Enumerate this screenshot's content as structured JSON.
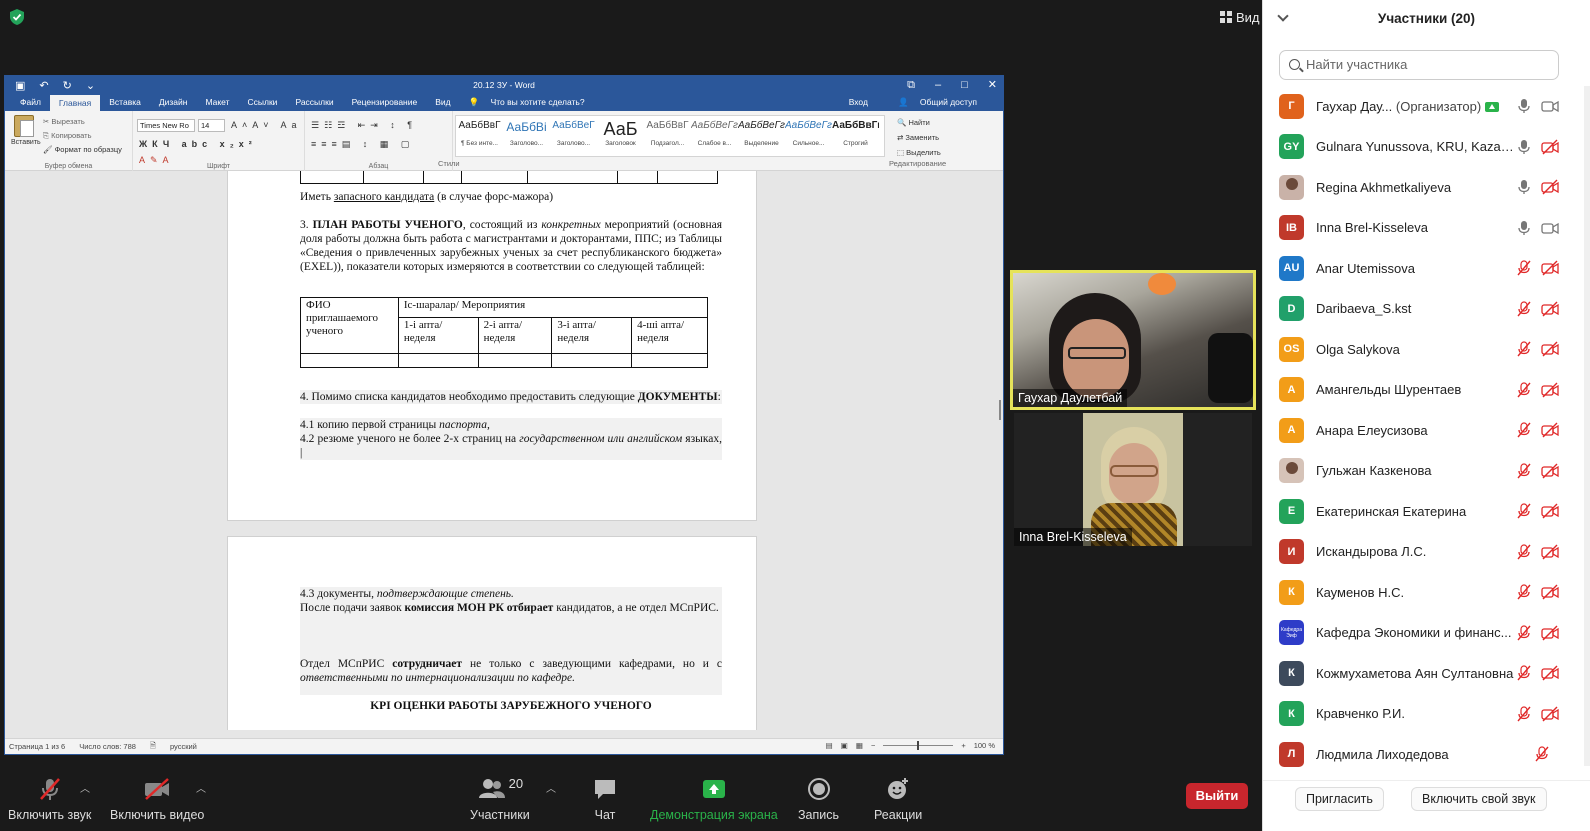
{
  "zoom_top": {
    "view_label": "Вид"
  },
  "word": {
    "doc_title": "20.12 ЗУ - Word",
    "tabs": [
      "Файл",
      "Главная",
      "Вставка",
      "Дизайн",
      "Макет",
      "Ссылки",
      "Рассылки",
      "Рецензирование",
      "Вид"
    ],
    "active_tab": "Главная",
    "tell_me": "Что вы хотите сделать?",
    "signin": "Вход",
    "share": "Общий доступ",
    "clipboard": {
      "paste": "Вставить",
      "cut": "Вырезать",
      "copy": "Копировать",
      "format": "Формат по образцу",
      "group": "Буфер обмена"
    },
    "font": {
      "name": "Times New Ro",
      "size": "14",
      "group": "Шрифт"
    },
    "paragraph_group": "Абзац",
    "styles_group": "Стили",
    "styles": [
      {
        "preview": "АаБбВвГ",
        "name": "¶ Без инте..."
      },
      {
        "preview": "АаБбВі",
        "name": "Заголово..."
      },
      {
        "preview": "АаБбВеГ",
        "name": "Заголово..."
      },
      {
        "preview": "АаБ",
        "name": "Заголовок"
      },
      {
        "preview": "АаБбВвГ",
        "name": "Подзагол..."
      },
      {
        "preview": "АаБбВеГг",
        "name": "Слабое в..."
      },
      {
        "preview": "АаБбВеГг",
        "name": "Выделение"
      },
      {
        "preview": "АаБбВеГг",
        "name": "Сильное..."
      },
      {
        "preview": "АаБбВвГг,",
        "name": "Строгий"
      }
    ],
    "editing": {
      "find": "Найти",
      "replace": "Заменить",
      "select": "Выделить",
      "group": "Редактирование"
    },
    "doc": {
      "p_reserve_a": "Иметь ",
      "p_reserve_u": "запасного кандидата",
      "p_reserve_b": " (в случае форс-мажора)",
      "p3_num": "3. ",
      "p3_bold": "ПЛАН РАБОТЫ УЧЕНОГО",
      "p3_a": ", состоящий из ",
      "p3_i": "конкретных",
      "p3_b": " мероприятий (основная доля работы должна быть работа с магистрантами и докторантами, ППС; из Таблицы «Сведения о привлеченных зарубежных ученых за счет республиканского бюджета» (EXEL)), показатели которых измеряются в соответствии со следующей таблицей:",
      "table": {
        "col1": "ФИО приглашаемого ученого",
        "events": "Іс-шаралар/ Мероприятия",
        "weeks": [
          "1-і апта/неделя",
          "2-і апта/неделя",
          "3-і апта/неделя",
          "4-ші апта/неделя"
        ]
      },
      "p4_a": "4. Помимо списка кандидатов необходимо предоставить следующие ",
      "p4_bold": "ДОКУМЕНТЫ",
      "p4_b": ":",
      "p41_a": "4.1 копию первой страницы ",
      "p41_i": "паспорта,",
      "p42_a": "4.2 резюме ученого не более 2-х страниц на ",
      "p42_i": "государственном или английском",
      "p42_b": " языках,",
      "p43_a": "4.3 документы, ",
      "p43_i": "подтверждающие степень.",
      "p_after_a": "После подачи заявок ",
      "p_after_bold": "комиссия МОН РК отбирает",
      "p_after_b": " кандидатов, а не отдел МСпРИС.",
      "p_dept_a": "Отдел МСпРИС ",
      "p_dept_bold": "сотрудничает",
      "p_dept_b": " не только с заведующими кафедрами, но и с ",
      "p_dept_i": "ответственными по интернационализации по кафедре.",
      "kpi": "KPI ОЦЕНКИ РАБОТЫ ЗАРУБЕЖНОГО УЧЕНОГО"
    },
    "status": {
      "page": "Страница 1 из 6",
      "words": "Число слов: 788",
      "lang": "русский",
      "zoom": "100 %"
    }
  },
  "videos": [
    {
      "name": "Гаухар Даулетбай"
    },
    {
      "name": "Inna Brel-Kisseleva"
    }
  ],
  "toolbar": {
    "mute": "Включить звук",
    "video": "Включить видео",
    "participants": "Участники",
    "participants_count": "20",
    "chat": "Чат",
    "share": "Демонстрация экрана",
    "record": "Запись",
    "reactions": "Реакции",
    "leave": "Выйти"
  },
  "panel": {
    "title": "Участники (20)",
    "search_placeholder": "Найти участника",
    "participants": [
      {
        "initials": "Г",
        "color": "#e0621c",
        "name": "Гаухар Дау...",
        "role": "(Организатор)",
        "mic": "on",
        "cam": "on"
      },
      {
        "initials": "GY",
        "color": "#23a35a",
        "name": "Gulnara Yunussova, KRU, Kazak...",
        "mic": "on",
        "cam": "off"
      },
      {
        "initials": "",
        "color": "#c9b2a8",
        "name": "Regina Akhmetkaliyeva",
        "mic": "on",
        "cam": "off"
      },
      {
        "initials": "IB",
        "color": "#c0392b",
        "name": "Inna Brel-Kisseleva",
        "mic": "on",
        "cam": "on"
      },
      {
        "initials": "AU",
        "color": "#1f78c8",
        "name": "Anar Utemissova",
        "mic": "off",
        "cam": "off"
      },
      {
        "initials": "D",
        "color": "#21a06a",
        "name": "Daribaeva_S.kst",
        "mic": "off",
        "cam": "off"
      },
      {
        "initials": "OS",
        "color": "#f29d18",
        "name": "Olga Salykova",
        "mic": "off",
        "cam": "off"
      },
      {
        "initials": "А",
        "color": "#f29d18",
        "name": "Амангельды Шурентаев",
        "mic": "off",
        "cam": "off"
      },
      {
        "initials": "А",
        "color": "#f29d18",
        "name": "Анара Елеусизова",
        "mic": "off",
        "cam": "off"
      },
      {
        "initials": "",
        "color": "#d6c3b8",
        "name": "Гульжан Казкенова",
        "mic": "off",
        "cam": "off"
      },
      {
        "initials": "Е",
        "color": "#23a35a",
        "name": "Екатеринская Екатерина",
        "mic": "off",
        "cam": "off"
      },
      {
        "initials": "И",
        "color": "#c0392b",
        "name": "Искандырова Л.С.",
        "mic": "off",
        "cam": "off"
      },
      {
        "initials": "К",
        "color": "#f29d18",
        "name": "Кауменов Н.С.",
        "mic": "off",
        "cam": "off"
      },
      {
        "initials": "Кафедра Эиф",
        "color": "#2e3cc8",
        "name": "Кафедра Экономики и финанс...",
        "mic": "off",
        "cam": "off"
      },
      {
        "initials": "К",
        "color": "#3d4a5c",
        "name": "Кожмухаметова Аян Султановна",
        "mic": "off",
        "cam": "off"
      },
      {
        "initials": "К",
        "color": "#23a35a",
        "name": "Кравченко Р.И.",
        "mic": "off",
        "cam": "off"
      },
      {
        "initials": "Л",
        "color": "#c0392b",
        "name": "Людмила  Лиходедова",
        "mic": "off",
        "cam": "none"
      }
    ],
    "invite": "Пригласить",
    "unmute_me": "Включить свой звук"
  }
}
